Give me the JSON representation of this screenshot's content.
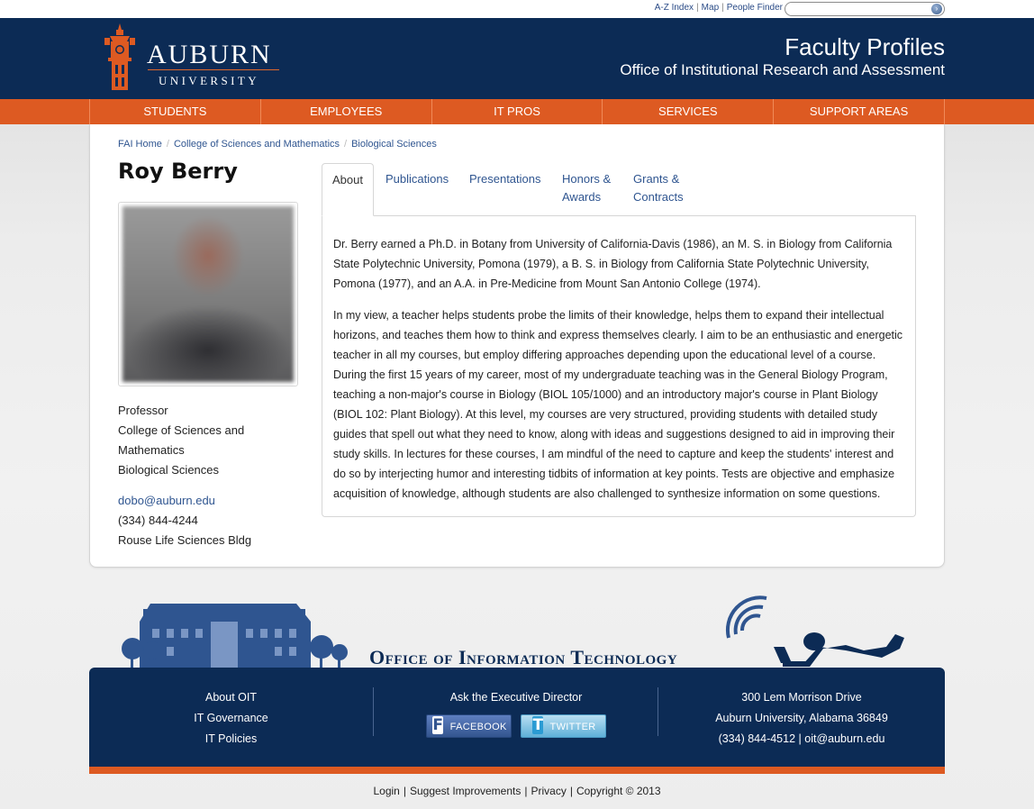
{
  "utility": {
    "links": [
      "A-Z Index",
      "Map",
      "People Finder"
    ],
    "search_placeholder": ""
  },
  "header": {
    "logo_main": "AUBURN",
    "logo_sub": "UNIVERSITY",
    "title": "Faculty Profiles",
    "subtitle": "Office of Institutional Research and Assessment"
  },
  "nav": {
    "items": [
      "STUDENTS",
      "EMPLOYEES",
      "IT PROS",
      "SERVICES",
      "SUPPORT AREAS"
    ]
  },
  "breadcrumb": [
    "FAI Home",
    "College of Sciences and Mathematics",
    "Biological Sciences"
  ],
  "profile": {
    "name": "Roy Berry",
    "title": "Professor",
    "college": "College of Sciences and Mathematics",
    "department": "Biological Sciences",
    "email": "dobo@auburn.edu",
    "phone": "(334) 844-4244",
    "building": "Rouse Life Sciences Bldg"
  },
  "tabs": [
    {
      "label": "About",
      "active": true
    },
    {
      "label": "Publications",
      "active": false
    },
    {
      "label": "Presentations",
      "active": false
    },
    {
      "label": "Honors & Awards",
      "active": false
    },
    {
      "label": "Grants & Contracts",
      "active": false
    }
  ],
  "about": {
    "p1": "Dr. Berry earned a Ph.D. in Botany from University of California-Davis (1986), an M. S. in Biology from California State Polytechnic University, Pomona (1979), a B. S. in Biology from California State Polytechnic University, Pomona (1977), and an A.A. in Pre-Medicine from Mount San Antonio College (1974).",
    "p2": "In my view, a teacher helps students probe the limits of their knowledge, helps them to expand their intellectual horizons, and teaches them how to think and express themselves clearly. I aim to be an enthusiastic and energetic teacher in all my courses, but employ differing approaches depending upon the educational level of a course. During the first 15 years of my career, most of my undergraduate teaching was in the General Biology Program, teaching a non-major's course in Biology (BIOL 105/1000) and an introductory major's course in Plant Biology (BIOL 102: Plant Biology). At this level, my courses are very structured, providing students with detailed study guides that spell out what they need to know, along with ideas and suggestions designed to aid in improving their study skills. In lectures for these courses, I am mindful of the need to capture and keep the students' interest and do so by interjecting humor and interesting tidbits of information at key points. Tests are objective and emphasize acquisition of knowledge, although students are also challenged to synthesize information on some questions."
  },
  "footer": {
    "oit_title": "Office of Information Technology",
    "col1": [
      "About OIT",
      "IT Governance",
      "IT Policies"
    ],
    "col2_heading": "Ask the Executive Director",
    "facebook_label": "FACEBOOK",
    "twitter_label": "TWITTER",
    "address_line1": "300 Lem Morrison Drive",
    "address_line2": "Auburn University, Alabama 36849",
    "phone": "(334) 844-4512",
    "email": "oit@auburn.edu"
  },
  "bottom_links": [
    "Login",
    "Suggest Improvements",
    "Privacy",
    "Copyright © 2013"
  ],
  "colors": {
    "navy": "#0c2b55",
    "orange": "#dd5a22",
    "link": "#2f5590"
  }
}
